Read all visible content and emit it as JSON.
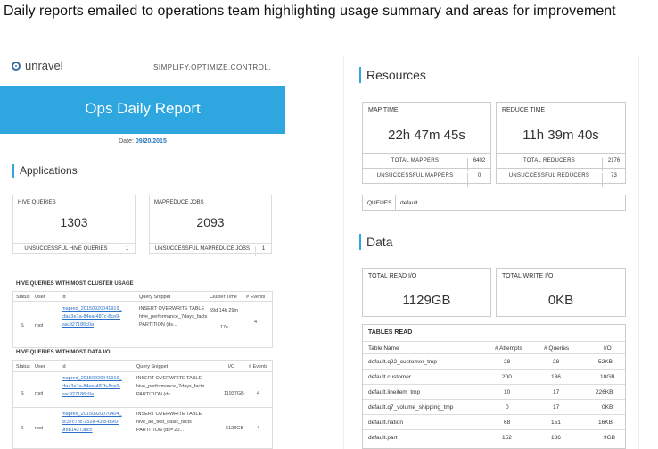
{
  "slide_title": "Daily reports emailed to operations team highlighting usage summary and areas for improvement",
  "left": {
    "logo_text": "unravel",
    "tagline": "SIMPLIFY.OPTIMIZE.CONTROL.",
    "banner_title": "Ops Daily Report",
    "date_label": "Date:",
    "date_value": "09/20/2015",
    "applications_title": "Applications",
    "hive_card": {
      "label": "HIVE QUERIES",
      "value": "1303",
      "row_label": "UNSUCCESSFUL HIVE QUERIES",
      "row_value": "1"
    },
    "mr_card": {
      "label": "MAPREDUCE JOBS",
      "value": "2093",
      "row_label": "UNSUCCESSFUL MAPREDUCE JOBS",
      "row_value": "1"
    },
    "usage_table": {
      "title": "HIVE QUERIES WITH MOST CLUSTER USAGE",
      "headers": [
        "Status",
        "User",
        "Id",
        "Query Snippet",
        "Cluster Time",
        "# Events"
      ],
      "rows": [
        {
          "status": "S",
          "user": "root",
          "id": [
            "mapred_20150920041919_",
            "cfaa3e7a-84ea-487c-8ce9-",
            "eac927186c0a"
          ],
          "snippet": [
            "INSERT OVERWRITE TABLE",
            "hive_performance_7days_facts",
            "PARTITION (ds..."
          ],
          "time": [
            "59d 14h 29m",
            "17s"
          ],
          "events": "4"
        }
      ]
    },
    "io_table": {
      "title": "HIVE QUERIES WITH MOST DATA I/O",
      "headers": [
        "Status",
        "User",
        "Id",
        "Query Snippet",
        "I/O",
        "# Events"
      ],
      "rows": [
        {
          "status": "S",
          "user": "root",
          "id": [
            "mapred_20150920041919_",
            "cfaa3e7a-84ea-487b-8ce9-",
            "eac927186c0a"
          ],
          "snippet": [
            "INSERT OVERWRITE TABLE",
            "hive_performance_7days_facts",
            "PARTITION (ds..."
          ],
          "io": "11937GB",
          "events": "4"
        },
        {
          "status": "S",
          "user": "root",
          "id": [
            "mapred_20150920070404_",
            "3c37c7bc-252e-43f8-b6f0-",
            "9f8b14273bcc"
          ],
          "snippet": [
            "INSERT OVERWRITE TABLE",
            "hive_ao_test_basic_facts",
            "PARTITION (ds='20..."
          ],
          "io": "5128GB",
          "events": "4"
        }
      ]
    }
  },
  "right": {
    "resources_title": "Resources",
    "map_card": {
      "label": "MAP TIME",
      "value": "22h 47m 45s",
      "rows": [
        {
          "label": "TOTAL MAPPERS",
          "value": "6402"
        },
        {
          "label": "UNSUCCESSFUL MAPPERS",
          "value": "0"
        }
      ]
    },
    "reduce_card": {
      "label": "REDUCE TIME",
      "value": "11h 39m 40s",
      "rows": [
        {
          "label": "TOTAL REDUCERS",
          "value": "2176"
        },
        {
          "label": "UNSUCCESSFUL REDUCERS",
          "value": "73"
        }
      ]
    },
    "queues_label": "QUEUES",
    "queues_value": "default",
    "data_title": "Data",
    "read_card": {
      "label": "TOTAL READ I/O",
      "value": "1129GB"
    },
    "write_card": {
      "label": "TOTAL WRITE I/O",
      "value": "0KB"
    },
    "tables_read": {
      "title": "TABLES READ",
      "headers": [
        "Table Name",
        "# Attempts",
        "# Queries",
        "I/O"
      ],
      "rows": [
        [
          "default.q22_customer_tmp",
          "28",
          "28",
          "52KB"
        ],
        [
          "default.customer",
          "200",
          "136",
          "18GB"
        ],
        [
          "default.lineitem_tmp",
          "10",
          "17",
          "226KB"
        ],
        [
          "default.q7_volume_shipping_tmp",
          "0",
          "17",
          "0KB"
        ],
        [
          "default.nation",
          "68",
          "151",
          "16KB"
        ],
        [
          "default.part",
          "152",
          "136",
          "9GB"
        ]
      ]
    }
  }
}
